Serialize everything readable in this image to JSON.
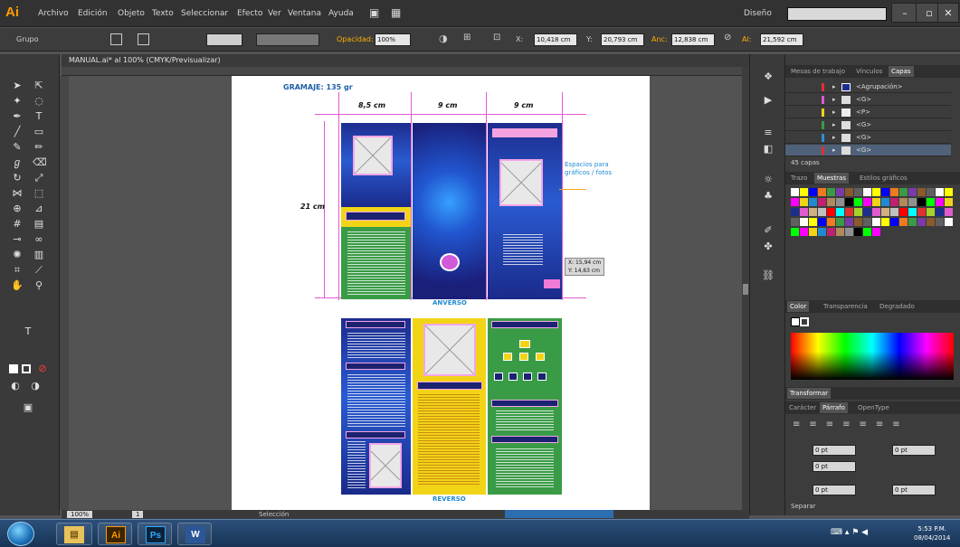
{
  "app": {
    "logo": "Ai",
    "menu": [
      "Archivo",
      "Edición",
      "Objeto",
      "Texto",
      "Seleccionar",
      "Efecto",
      "Ver",
      "Ventana",
      "Ayuda"
    ],
    "workspace": "Diseño",
    "window_buttons": [
      "–",
      "▫",
      "✕"
    ]
  },
  "controlbar": {
    "selection_label": "Grupo",
    "opacity_label": "Opacidad:",
    "opacity_value": "100%",
    "x_label": "X:",
    "x_value": "10,418 cm",
    "y_label": "Y:",
    "y_value": "20,793 cm",
    "w_label": "Anc:",
    "w_value": "12,838 cm",
    "h_label": "Al:",
    "h_value": "21,592 cm"
  },
  "document": {
    "tab_title": "MANUAL.ai* al 100% (CMYK/Previsualizar)",
    "title": "GRAMAJE: 135 gr",
    "dimensions": [
      "8,5 cm",
      "9 cm",
      "9 cm"
    ],
    "height_dim": "21 cm",
    "callout": [
      "Espacios para",
      "gráficos / fotos"
    ],
    "coords": [
      "X: 15,94 cm",
      "Y: 14,63 cm"
    ],
    "caption_front": "ANVERSO",
    "caption_back": "REVERSO"
  },
  "panels": {
    "layers_tabs": [
      "Mesas de trabajo",
      "Vínculos",
      "Capas"
    ],
    "layers": [
      "<Agrupación>",
      "<G>",
      "<P>",
      "<G>",
      "<G>",
      "<G>"
    ],
    "layers_count": "45 capas",
    "swatches_tabs": [
      "Trazo",
      "Muestras",
      "Estilos gráficos"
    ],
    "color_tabs": [
      "Color",
      "Transparencia",
      "Degradado"
    ],
    "transform_tab": "Transformar",
    "align_tabs": [
      "Carácter",
      "Párrafo",
      "OpenType"
    ],
    "para_values": [
      "0 pt",
      "0 pt",
      "0 pt",
      "0 pt",
      "0 pt"
    ],
    "hyphen_label": "Separar"
  },
  "statusbar": {
    "zoom": "100%",
    "page": "1",
    "tool": "Selección"
  },
  "taskbar": {
    "apps": [
      "Ai",
      "Ps",
      "W"
    ],
    "time": "5:53 P.M.",
    "date": "08/04/2014"
  },
  "colors": {
    "blue_panel": "#1d2d8f",
    "yellow_panel": "#f2d417",
    "green_panel": "#3a9b46",
    "guide_magenta": "#e05ad0",
    "caption_blue": "#1f8ad1"
  }
}
